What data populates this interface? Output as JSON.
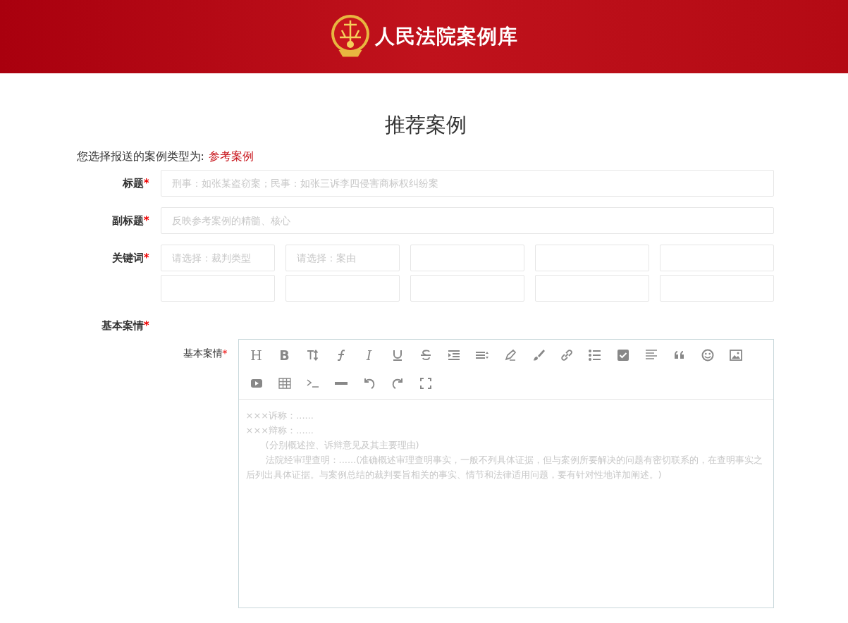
{
  "header": {
    "site_name": "人民法院案例库"
  },
  "page_title": "推荐案例",
  "case_type": {
    "label": "您选择报送的案例类型为:",
    "value": "参考案例"
  },
  "fields": [
    {
      "label": "标题",
      "required_mark": "*",
      "placeholder": "刑事：如张某盗窃案；民事：如张三诉李四侵害商标权纠纷案"
    },
    {
      "label": "副标题",
      "required_mark": "*",
      "placeholder": "反映参考案例的精髓、核心"
    }
  ],
  "keywords": {
    "label": "关键词",
    "required_mark": "*",
    "inputs": [
      {
        "kind": "select",
        "placeholder": "请选择：裁判类型"
      },
      {
        "kind": "select",
        "placeholder": "请选择：案由"
      },
      {
        "kind": "blank"
      },
      {
        "kind": "blank"
      },
      {
        "kind": "blank"
      },
      {
        "kind": "blank"
      },
      {
        "kind": "blank"
      },
      {
        "kind": "blank"
      },
      {
        "kind": "blank"
      },
      {
        "kind": "blank"
      }
    ]
  },
  "section": {
    "label": "基本案情",
    "required_mark": "*"
  },
  "editor": {
    "label": "基本案情",
    "required_mark": "*",
    "toolbar": [
      {
        "kind": "heading",
        "glyph": "H"
      },
      {
        "kind": "bold",
        "glyph": "B"
      },
      {
        "kind": "text-size"
      },
      {
        "kind": "font"
      },
      {
        "kind": "italic",
        "glyph": "I"
      },
      {
        "kind": "underline"
      },
      {
        "kind": "strike"
      },
      {
        "kind": "indent"
      },
      {
        "kind": "line-height"
      },
      {
        "kind": "pen"
      },
      {
        "kind": "brush"
      },
      {
        "kind": "link"
      },
      {
        "kind": "list"
      },
      {
        "kind": "checkbox"
      },
      {
        "kind": "align"
      },
      {
        "kind": "quote"
      },
      {
        "kind": "smiley"
      },
      {
        "kind": "image"
      },
      {
        "kind": "video"
      },
      {
        "kind": "table"
      },
      {
        "kind": "code"
      },
      {
        "kind": "hr"
      },
      {
        "kind": "undo"
      },
      {
        "kind": "redo"
      },
      {
        "kind": "fullscreen"
      }
    ],
    "placeholder_lines": [
      {
        "text": "×××诉称：......",
        "indented": false
      },
      {
        "text": "×××辩称：......",
        "indented": false
      },
      {
        "text": "(分别概述控、诉辩意见及其主要理由)",
        "indented": true
      },
      {
        "text": "法院经审理查明：......(准确概述审理查明事实，一般不列具体证据，但与案例所要解决的问题有密切联系的，在查明事实之后列出具体证据。与案例总结的裁判要旨相关的事实、情节和法律适用问题，要有针对性地详加阐述。)",
        "indented": true
      }
    ]
  }
}
